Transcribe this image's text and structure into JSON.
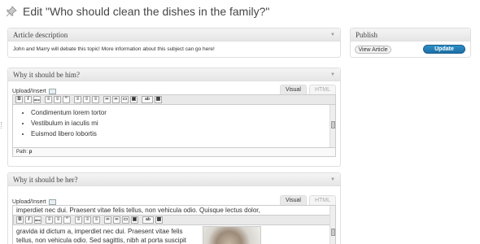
{
  "page": {
    "title": "Edit \"Who should clean the dishes in the family?\""
  },
  "article_description": {
    "heading": "Article description",
    "text": "John and Marry will debate this topic! More information about this subject can go here!"
  },
  "publish": {
    "heading": "Publish",
    "view_label": "View Article",
    "update_label": "Update",
    "accent": "#21759b"
  },
  "editor1": {
    "heading": "Why it should be him?",
    "upload_label": "Upload/Insert",
    "tab_visual": "Visual",
    "tab_html": "HTML",
    "bullets": [
      "Condimentum lorem tortor",
      "Vestibulum in iaculis mi",
      "Euismod libero lobortis"
    ],
    "path_label": "Path:",
    "path_value": "p"
  },
  "editor2": {
    "heading": "Why it should be her?",
    "upload_label": "Upload/Insert",
    "tab_visual": "Visual",
    "tab_html": "HTML",
    "lines": [
      "imperdiet nec dui. Praesent vitae felis tellus, non vehicula odio. Quisque lectus dolor,",
      "gravida id dictum a, imperdiet nec dui. Praesent vitae felis",
      "tellus, non vehicula odio. Sed sagittis, nibh at porta suscipit"
    ]
  },
  "toolbar_buttons": [
    {
      "name": "bold-button",
      "glyph": "B"
    },
    {
      "name": "italic-button",
      "glyph": "I"
    },
    {
      "name": "strikethrough-button",
      "glyph": "abc"
    },
    {
      "name": "bullet-list-button",
      "glyph": "≡"
    },
    {
      "name": "numbered-list-button",
      "glyph": "≡"
    },
    {
      "name": "blockquote-button",
      "glyph": "“"
    },
    {
      "name": "align-left-button",
      "glyph": "≡"
    },
    {
      "name": "align-center-button",
      "glyph": "≡"
    },
    {
      "name": "align-right-button",
      "glyph": "≡"
    },
    {
      "name": "insert-link-button",
      "glyph": "∞"
    },
    {
      "name": "unlink-button",
      "glyph": "∞"
    },
    {
      "name": "insert-more-button",
      "glyph": "▭"
    },
    {
      "name": "fullscreen-button",
      "glyph": "▣"
    },
    {
      "name": "spellcheck-button",
      "glyph": "ab"
    },
    {
      "name": "kitchen-sink-button",
      "glyph": "▦"
    }
  ]
}
